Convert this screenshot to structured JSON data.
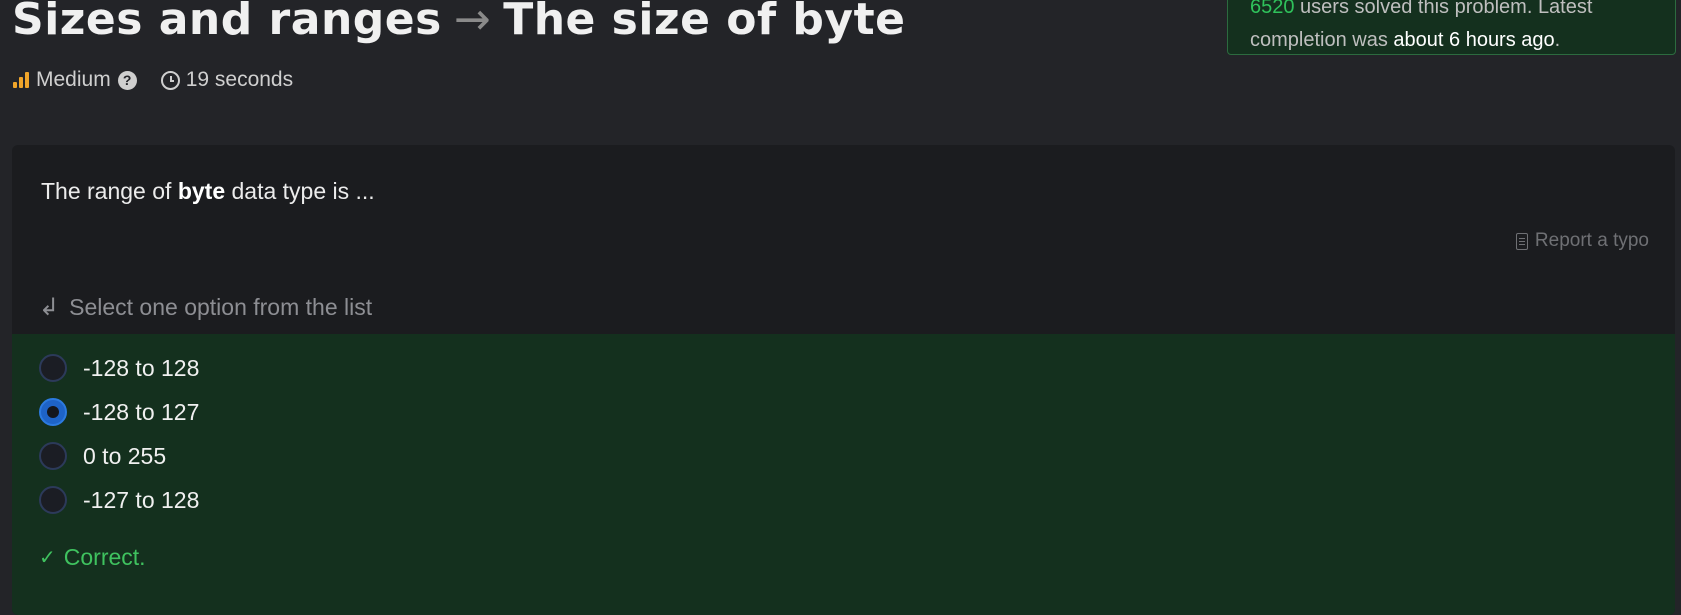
{
  "header": {
    "topic": "Sizes and ranges",
    "arrow": "→",
    "title": "The size of byte",
    "difficulty": "Medium",
    "help_glyph": "?",
    "time": "19 seconds"
  },
  "stats": {
    "line1_count": "6520",
    "line1_text": " users solved this problem. Latest",
    "line2_prefix": "completion was ",
    "line2_time": "about 6 hours ago",
    "line2_suffix": "."
  },
  "question": {
    "prefix": "The range of ",
    "keyword": "byte",
    "suffix": " data type is ..."
  },
  "report_label": "Report a typo",
  "instruction_glyph": "↲",
  "instruction": "Select one option from the list",
  "options": [
    {
      "label": "-128 to 128",
      "selected": false
    },
    {
      "label": "-128 to 127",
      "selected": true
    },
    {
      "label": "0 to 255",
      "selected": false
    },
    {
      "label": "-127 to 128",
      "selected": false
    }
  ],
  "result": {
    "check_glyph": "✓",
    "label": "Correct."
  },
  "colors": {
    "background": "#232428",
    "card": "#1b1c1f",
    "success_bg": "#14301e",
    "success_text": "#3fc25f",
    "difficulty_icon": "#f0a52a",
    "radio_selected": "#1e63c7"
  },
  "icons": [
    "difficulty-bars-icon",
    "help-icon",
    "clock-icon",
    "document-icon",
    "arrow-down-icon",
    "checkmark-icon"
  ]
}
